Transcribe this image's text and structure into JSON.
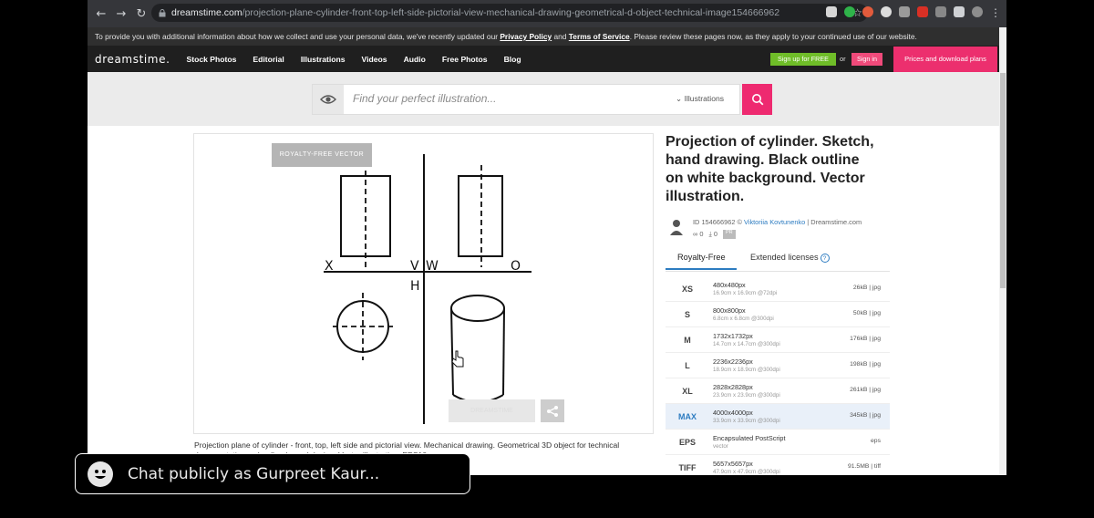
{
  "browser": {
    "url_host": "dreamstime.com",
    "url_path": "/projection-plane-cylinder-front-top-left-side-pictorial-view-mechanical-drawing-geometrical-d-object-technical-image154666962",
    "back_icon": "←",
    "forward_icon": "→",
    "reload_icon": "↻",
    "star_icon": "☆",
    "menu_icon": "⋮"
  },
  "notice": {
    "text_before": "To provide you with additional information about how we collect and use your personal data, we've recently updated our ",
    "privacy": "Privacy Policy",
    "and": " and ",
    "terms": "Terms of Service",
    "text_after": ". Please review these pages now, as they apply to your continued use of our website."
  },
  "nav": {
    "logo": "dreamstime.",
    "links": [
      "Stock Photos",
      "Editorial",
      "Illustrations",
      "Videos",
      "Audio",
      "Free Photos",
      "Blog"
    ],
    "signup": "Sign up for FREE",
    "or": "or",
    "signin": "Sign in",
    "prices": "Prices and download plans"
  },
  "search": {
    "placeholder": "Find your perfect illustration...",
    "category": "Illustrations"
  },
  "image": {
    "badge": "ROYALTY-FREE VECTOR",
    "drawing_labels": {
      "x": "X",
      "v": "V",
      "w": "W",
      "o": "O",
      "h": "H"
    },
    "watermark_button": "DREAMSTIME",
    "caption": "Projection plane of cylinder - front, top, left side and pictorial view. Mechanical drawing. Geometrical 3D object for technical documentation, schoolbooks and design. Vector illustration. EPS10"
  },
  "details": {
    "title": "Projection of cylinder. Sketch, hand drawing. Black outline on white background. Vector illustration.",
    "id_text": "ID 154666962 © ",
    "author": "Viktoriia Kovtunenko",
    "site": " | Dreamstime.com",
    "stat1": "0",
    "stat2": "0",
    "pr": "PR"
  },
  "license_tabs": {
    "royalty_free": "Royalty-Free",
    "extended": "Extended licenses",
    "help": "?"
  },
  "sizes": [
    {
      "code": "XS",
      "dims": "480x480px",
      "detail": "16.9cm x 16.9cm @72dpi",
      "file": "26kB | jpg"
    },
    {
      "code": "S",
      "dims": "800x800px",
      "detail": "6.8cm x 6.8cm @300dpi",
      "file": "50kB | jpg"
    },
    {
      "code": "M",
      "dims": "1732x1732px",
      "detail": "14.7cm x 14.7cm @300dpi",
      "file": "176kB | jpg"
    },
    {
      "code": "L",
      "dims": "2236x2236px",
      "detail": "18.9cm x 18.9cm @300dpi",
      "file": "198kB | jpg"
    },
    {
      "code": "XL",
      "dims": "2828x2828px",
      "detail": "23.9cm x 23.9cm @300dpi",
      "file": "261kB | jpg"
    },
    {
      "code": "MAX",
      "dims": "4000x4000px",
      "detail": "33.9cm x 33.9cm @300dpi",
      "file": "345kB | jpg"
    },
    {
      "code": "EPS",
      "dims": "Encapsulated PostScript",
      "detail": "vector",
      "file": "eps"
    },
    {
      "code": "TIFF",
      "dims": "5657x5657px",
      "detail": "47.9cm x 47.9cm @300dpi",
      "file": "91.5MB | tiff"
    }
  ],
  "selected_size": "MAX",
  "chat": {
    "prompt": "Chat publicly as Gurpreet Kaur..."
  },
  "colors": {
    "brand_pink": "#ec2f6e",
    "signup_green": "#6fbd28",
    "link_blue": "#2d7cc1"
  }
}
